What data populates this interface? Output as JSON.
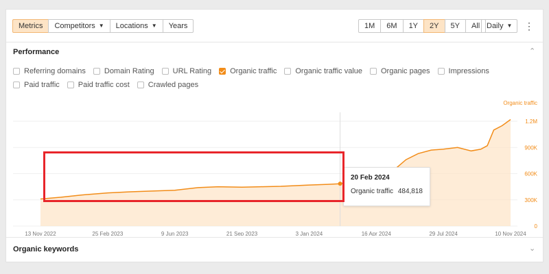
{
  "toolbar": {
    "left_buttons": [
      {
        "label": "Metrics",
        "active": true
      },
      {
        "label": "Competitors",
        "caret": true
      },
      {
        "label": "Locations",
        "caret": true
      },
      {
        "label": "Years"
      }
    ],
    "ranges": [
      "1M",
      "6M",
      "1Y",
      "2Y",
      "5Y",
      "All"
    ],
    "active_range": "2Y",
    "granularity": "Daily",
    "more_icon": "kebab-icon"
  },
  "performance": {
    "title": "Performance",
    "collapse_icon": "chevron-up-icon",
    "checkboxes": [
      {
        "label": "Referring domains",
        "checked": false
      },
      {
        "label": "Domain Rating",
        "checked": false
      },
      {
        "label": "URL Rating",
        "checked": false
      },
      {
        "label": "Organic traffic",
        "checked": true
      },
      {
        "label": "Organic traffic value",
        "checked": false
      },
      {
        "label": "Organic pages",
        "checked": false
      },
      {
        "label": "Impressions",
        "checked": false
      },
      {
        "label": "Paid traffic",
        "checked": false
      },
      {
        "label": "Paid traffic cost",
        "checked": false
      },
      {
        "label": "Crawled pages",
        "checked": false
      }
    ]
  },
  "chart_data": {
    "type": "area",
    "series_label": "Organic traffic",
    "x_ticks": [
      "13 Nov 2022",
      "25 Feb 2023",
      "9 Jun 2023",
      "21 Sep 2023",
      "3 Jan 2024",
      "16 Apr 2024",
      "29 Jul 2024",
      "10 Nov 2024"
    ],
    "y_ticks": [
      "0",
      "300K",
      "600K",
      "900K",
      "1.2M"
    ],
    "y_values": [
      0,
      300000,
      600000,
      900000,
      1200000
    ],
    "ylim": [
      0,
      1200000
    ],
    "xlim": [
      "2022-11-13",
      "2024-11-10"
    ],
    "series": [
      {
        "name": "Organic traffic",
        "color": "#f28c18",
        "points": [
          [
            "2022-11-13",
            310000
          ],
          [
            "2022-12-15",
            330000
          ],
          [
            "2023-01-15",
            355000
          ],
          [
            "2023-02-25",
            380000
          ],
          [
            "2023-04-01",
            392000
          ],
          [
            "2023-05-01",
            400000
          ],
          [
            "2023-06-09",
            410000
          ],
          [
            "2023-07-15",
            440000
          ],
          [
            "2023-08-15",
            450000
          ],
          [
            "2023-09-21",
            445000
          ],
          [
            "2023-10-20",
            450000
          ],
          [
            "2023-11-20",
            455000
          ],
          [
            "2024-01-03",
            470000
          ],
          [
            "2024-02-01",
            478000
          ],
          [
            "2024-02-20",
            484818
          ],
          [
            "2024-03-10",
            520000
          ],
          [
            "2024-04-16",
            560000
          ],
          [
            "2024-05-10",
            620000
          ],
          [
            "2024-06-01",
            760000
          ],
          [
            "2024-06-20",
            830000
          ],
          [
            "2024-07-10",
            870000
          ],
          [
            "2024-07-29",
            880000
          ],
          [
            "2024-08-20",
            900000
          ],
          [
            "2024-09-10",
            860000
          ],
          [
            "2024-09-25",
            880000
          ],
          [
            "2024-10-05",
            920000
          ],
          [
            "2024-10-15",
            1100000
          ],
          [
            "2024-10-28",
            1150000
          ],
          [
            "2024-11-10",
            1220000
          ]
        ]
      }
    ],
    "tooltip": {
      "date": "20 Feb 2024",
      "label": "Organic traffic",
      "value": "484,818"
    }
  },
  "organic_keywords": {
    "title": "Organic keywords",
    "expand_icon": "chevron-down-icon"
  },
  "colors": {
    "accent": "#f28c18",
    "highlight": "#e8252a"
  }
}
